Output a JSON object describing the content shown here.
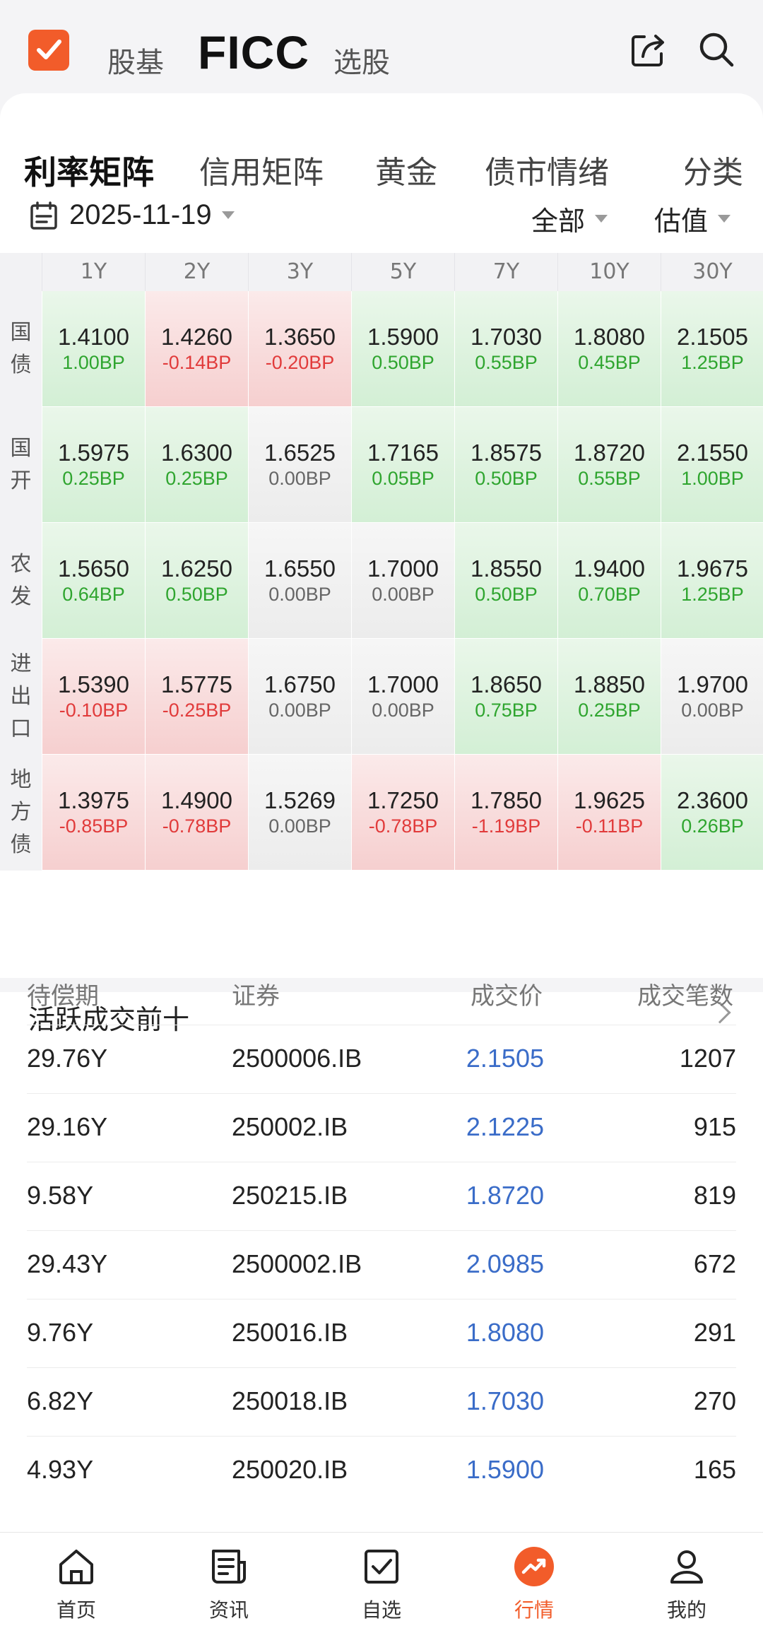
{
  "header": {
    "nav": [
      "股基",
      "FICC",
      "选股"
    ],
    "active": "FICC"
  },
  "tabs": [
    "利率矩阵",
    "信用矩阵",
    "黄金",
    "债市情绪",
    "分类"
  ],
  "active_tab": "利率矩阵",
  "filters": {
    "date": "2025-11-19",
    "scope": "全部",
    "measure": "估值"
  },
  "matrix": {
    "columns": [
      "1Y",
      "2Y",
      "3Y",
      "5Y",
      "7Y",
      "10Y",
      "30Y"
    ],
    "rows": [
      {
        "label": [
          "国",
          "债"
        ],
        "cells": [
          {
            "rate": "1.4100",
            "chg": "1.00BP",
            "dir": "up"
          },
          {
            "rate": "1.4260",
            "chg": "-0.14BP",
            "dir": "down"
          },
          {
            "rate": "1.3650",
            "chg": "-0.20BP",
            "dir": "down"
          },
          {
            "rate": "1.5900",
            "chg": "0.50BP",
            "dir": "up"
          },
          {
            "rate": "1.7030",
            "chg": "0.55BP",
            "dir": "up"
          },
          {
            "rate": "1.8080",
            "chg": "0.45BP",
            "dir": "up"
          },
          {
            "rate": "2.1505",
            "chg": "1.25BP",
            "dir": "up"
          }
        ]
      },
      {
        "label": [
          "国",
          "开"
        ],
        "cells": [
          {
            "rate": "1.5975",
            "chg": "0.25BP",
            "dir": "up"
          },
          {
            "rate": "1.6300",
            "chg": "0.25BP",
            "dir": "up"
          },
          {
            "rate": "1.6525",
            "chg": "0.00BP",
            "dir": "flat"
          },
          {
            "rate": "1.7165",
            "chg": "0.05BP",
            "dir": "up"
          },
          {
            "rate": "1.8575",
            "chg": "0.50BP",
            "dir": "up"
          },
          {
            "rate": "1.8720",
            "chg": "0.55BP",
            "dir": "up"
          },
          {
            "rate": "2.1550",
            "chg": "1.00BP",
            "dir": "up"
          }
        ]
      },
      {
        "label": [
          "农",
          "发"
        ],
        "cells": [
          {
            "rate": "1.5650",
            "chg": "0.64BP",
            "dir": "up"
          },
          {
            "rate": "1.6250",
            "chg": "0.50BP",
            "dir": "up"
          },
          {
            "rate": "1.6550",
            "chg": "0.00BP",
            "dir": "flat"
          },
          {
            "rate": "1.7000",
            "chg": "0.00BP",
            "dir": "flat"
          },
          {
            "rate": "1.8550",
            "chg": "0.50BP",
            "dir": "up"
          },
          {
            "rate": "1.9400",
            "chg": "0.70BP",
            "dir": "up"
          },
          {
            "rate": "1.9675",
            "chg": "1.25BP",
            "dir": "up"
          }
        ]
      },
      {
        "label": [
          "进",
          "出",
          "口"
        ],
        "cells": [
          {
            "rate": "1.5390",
            "chg": "-0.10BP",
            "dir": "down"
          },
          {
            "rate": "1.5775",
            "chg": "-0.25BP",
            "dir": "down"
          },
          {
            "rate": "1.6750",
            "chg": "0.00BP",
            "dir": "flat"
          },
          {
            "rate": "1.7000",
            "chg": "0.00BP",
            "dir": "flat"
          },
          {
            "rate": "1.8650",
            "chg": "0.75BP",
            "dir": "up"
          },
          {
            "rate": "1.8850",
            "chg": "0.25BP",
            "dir": "up"
          },
          {
            "rate": "1.9700",
            "chg": "0.00BP",
            "dir": "flat"
          }
        ]
      },
      {
        "label": [
          "地",
          "方",
          "债"
        ],
        "cells": [
          {
            "rate": "1.3975",
            "chg": "-0.85BP",
            "dir": "down"
          },
          {
            "rate": "1.4900",
            "chg": "-0.78BP",
            "dir": "down"
          },
          {
            "rate": "1.5269",
            "chg": "0.00BP",
            "dir": "flat"
          },
          {
            "rate": "1.7250",
            "chg": "-0.78BP",
            "dir": "down"
          },
          {
            "rate": "1.7850",
            "chg": "-1.19BP",
            "dir": "down"
          },
          {
            "rate": "1.9625",
            "chg": "-0.11BP",
            "dir": "down"
          },
          {
            "rate": "2.3600",
            "chg": "0.26BP",
            "dir": "up"
          }
        ]
      }
    ]
  },
  "active_trades": {
    "title": "活跃成交前十",
    "headers": [
      "待偿期",
      "证券",
      "成交价",
      "成交笔数"
    ],
    "rows": [
      {
        "term": "29.76Y",
        "code": "2500006.IB",
        "price": "2.1505",
        "count": "1207"
      },
      {
        "term": "29.16Y",
        "code": "250002.IB",
        "price": "2.1225",
        "count": "915"
      },
      {
        "term": "9.58Y",
        "code": "250215.IB",
        "price": "1.8720",
        "count": "819"
      },
      {
        "term": "29.43Y",
        "code": "2500002.IB",
        "price": "2.0985",
        "count": "672"
      },
      {
        "term": "9.76Y",
        "code": "250016.IB",
        "price": "1.8080",
        "count": "291"
      },
      {
        "term": "6.82Y",
        "code": "250018.IB",
        "price": "1.7030",
        "count": "270"
      },
      {
        "term": "4.93Y",
        "code": "250020.IB",
        "price": "1.5900",
        "count": "165"
      }
    ]
  },
  "bottom_nav": [
    {
      "label": "首页",
      "icon": "home-icon"
    },
    {
      "label": "资讯",
      "icon": "news-icon"
    },
    {
      "label": "自选",
      "icon": "watchlist-icon"
    },
    {
      "label": "行情",
      "icon": "market-icon",
      "active": true
    },
    {
      "label": "我的",
      "icon": "profile-icon"
    }
  ],
  "colors": {
    "accent": "#f25c2a",
    "up": "#2fa52f",
    "down": "#e13b3b",
    "price": "#3a6cc8"
  }
}
